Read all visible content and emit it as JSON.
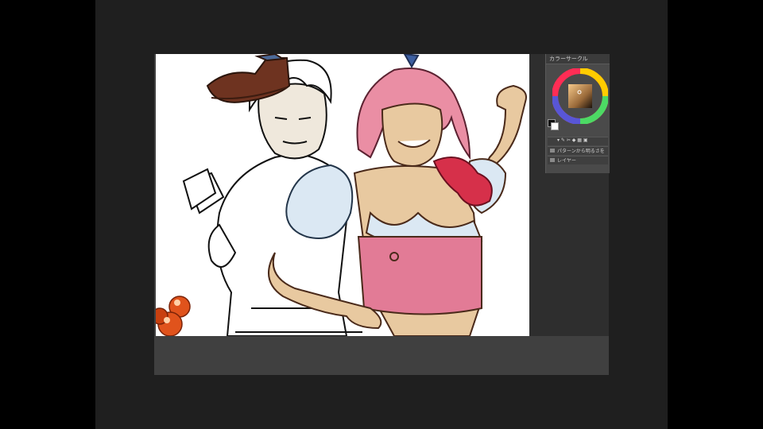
{
  "player": {
    "letterbox": "black side bars"
  },
  "app": {
    "canvas_background": "#ffffff",
    "workspace_color": "#3a3a3a",
    "panel_color": "#4a4a4a"
  },
  "color_panel": {
    "title": "カラーサークル",
    "rows": [
      {
        "label": "▾ ✎ ✂  ◆  ▦  ▣",
        "icon": "tool-icon"
      },
      {
        "label": "パターンから明るさを",
        "icon": "option-icon"
      },
      {
        "label": "レイヤー",
        "icon": "layer-icon"
      }
    ],
    "wheel_icon": "color-wheel-icon"
  },
  "canvas": {
    "subject": "illustration in progress",
    "colors": {
      "skin": "#e8c9a0",
      "shirt_pink": "#e27b96",
      "sleeve_blue": "#d9e8f3",
      "hair_pink": "#ea8ea4",
      "scarf_red": "#d6304a",
      "boot_brown": "#6e3320",
      "orb_orange": "#e0531c"
    }
  }
}
